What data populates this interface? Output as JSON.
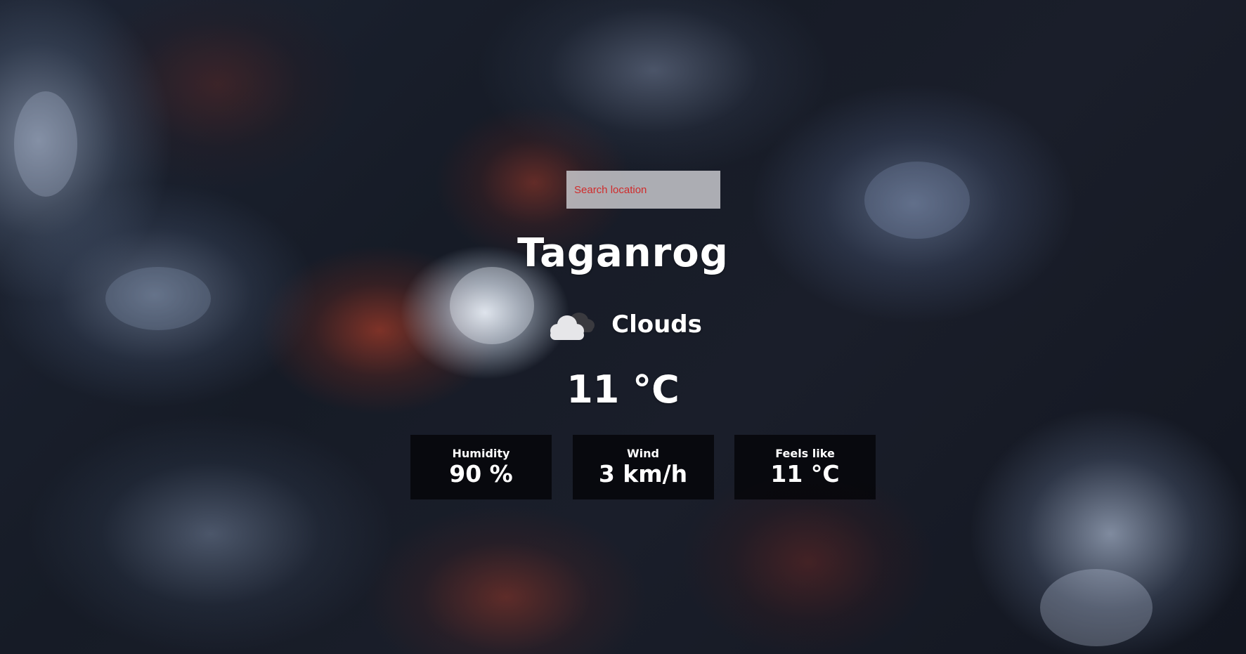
{
  "search": {
    "value": "",
    "placeholder": "Search location"
  },
  "location": {
    "city": "Taganrog"
  },
  "weather": {
    "condition": "Clouds",
    "condition_icon": "clouds-icon",
    "temperature": "11 °C"
  },
  "stats": [
    {
      "label": "Humidity",
      "value": "90 %"
    },
    {
      "label": "Wind",
      "value": "3 km/h"
    },
    {
      "label": "Feels like",
      "value": "11 °C"
    }
  ],
  "colors": {
    "placeholder_text": "#d02b2b",
    "search_background": "#cdcdd2",
    "text": "#ffffff",
    "stat_card_background": "#050508"
  }
}
